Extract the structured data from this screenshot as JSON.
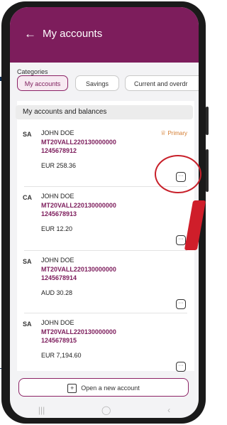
{
  "header": {
    "back_icon": "arrow-left-icon",
    "title": "My accounts"
  },
  "categories": {
    "label": "Categories",
    "chips": [
      {
        "label": "My accounts",
        "active": true
      },
      {
        "label": "Savings",
        "active": false
      },
      {
        "label": "Current and overdr",
        "active": false
      }
    ]
  },
  "section": {
    "title": "My accounts and balances"
  },
  "accounts": [
    {
      "type": "SA",
      "name": "JOHN DOE",
      "iban": "MT20VALL220130000000",
      "number": "1245678912",
      "balance": "EUR 258.36",
      "badge": "Primary"
    },
    {
      "type": "CA",
      "name": "JOHN DOE",
      "iban": "MT20VALL220130000000",
      "number": "1245678913",
      "balance": "EUR 12.20",
      "badge": ""
    },
    {
      "type": "SA",
      "name": "JOHN DOE",
      "iban": "MT20VALL220130000000",
      "number": "1245678914",
      "balance": "AUD 30.28",
      "badge": ""
    },
    {
      "type": "SA",
      "name": "JOHN DOE",
      "iban": "MT20VALL220130000000",
      "number": "1245678915",
      "balance": "EUR 7,194.60",
      "badge": ""
    }
  ],
  "more_glyph": "···",
  "footer": {
    "open_account_label": "Open a new account",
    "plus_glyph": "+"
  },
  "nav": {
    "recents_glyph": "|||",
    "home_glyph": "◯",
    "back_glyph": "‹"
  },
  "colors": {
    "accent": "#7d1d5c",
    "primary_badge": "#d37b2e",
    "annotation": "#c8202a"
  }
}
